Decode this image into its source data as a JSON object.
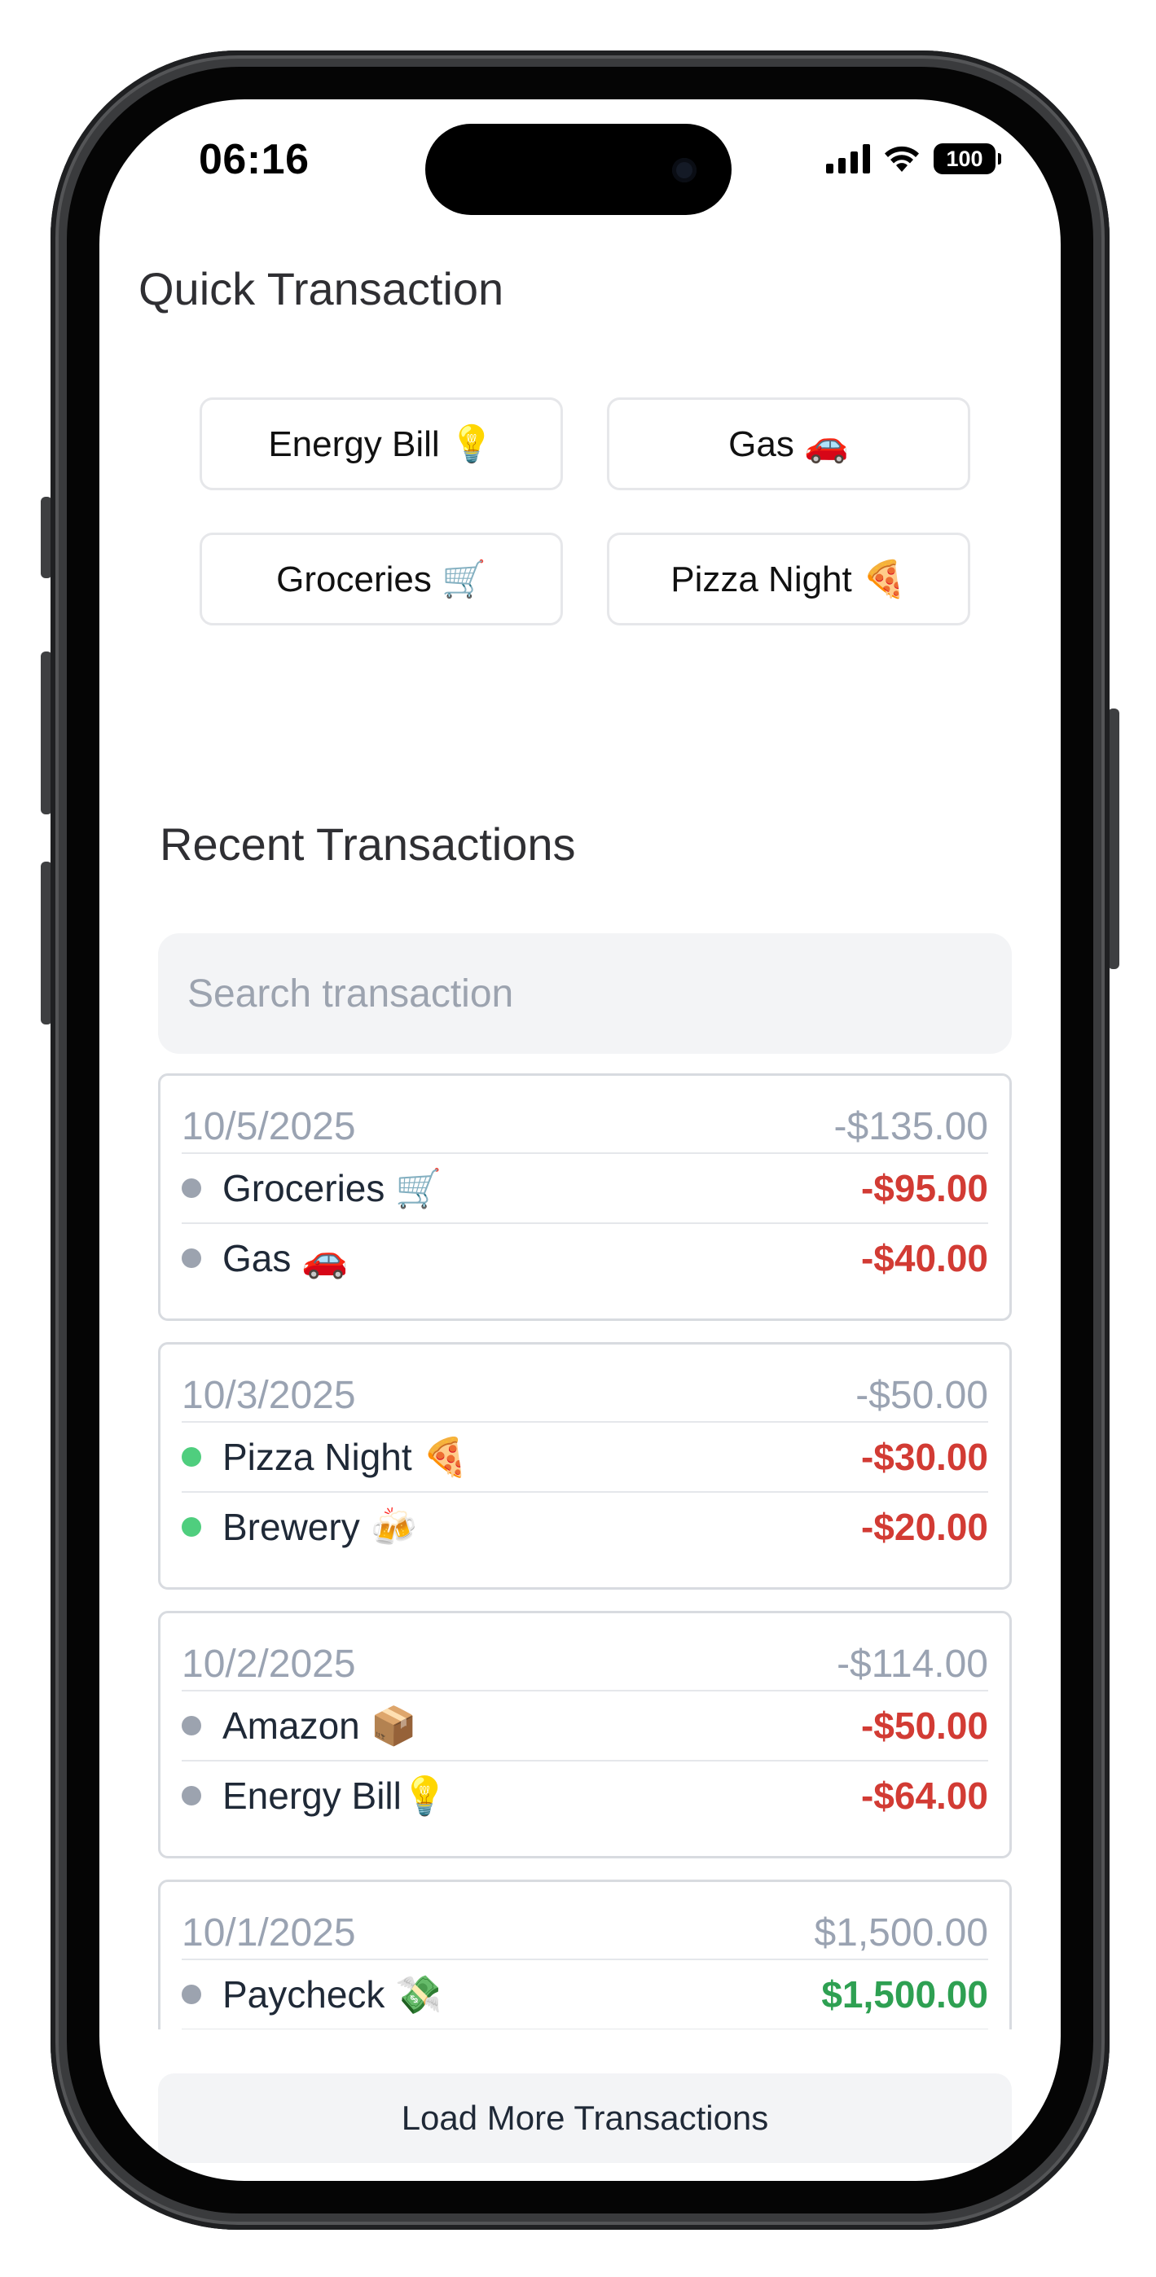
{
  "status_bar": {
    "time": "06:16",
    "battery": "100"
  },
  "quick": {
    "title": "Quick Transaction",
    "buttons": [
      {
        "label": "Energy Bill 💡"
      },
      {
        "label": "Gas 🚗"
      },
      {
        "label": "Groceries 🛒"
      },
      {
        "label": "Pizza Night 🍕"
      }
    ]
  },
  "recent": {
    "title": "Recent Transactions",
    "search_placeholder": "Search transaction",
    "groups": [
      {
        "date": "10/5/2025",
        "total": "-$135.00",
        "items": [
          {
            "name": "Groceries 🛒",
            "amount": "-$95.00",
            "dot_color": "#9ca3af",
            "amount_color": "#d23b34"
          },
          {
            "name": "Gas 🚗",
            "amount": "-$40.00",
            "dot_color": "#9ca3af",
            "amount_color": "#d23b34"
          }
        ]
      },
      {
        "date": "10/3/2025",
        "total": "-$50.00",
        "items": [
          {
            "name": "Pizza Night 🍕",
            "amount": "-$30.00",
            "dot_color": "#4fce7e",
            "amount_color": "#d23b34"
          },
          {
            "name": "Brewery 🍻",
            "amount": "-$20.00",
            "dot_color": "#4fce7e",
            "amount_color": "#d23b34"
          }
        ]
      },
      {
        "date": "10/2/2025",
        "total": "-$114.00",
        "items": [
          {
            "name": "Amazon 📦",
            "amount": "-$50.00",
            "dot_color": "#9ca3af",
            "amount_color": "#d23b34"
          },
          {
            "name": "Energy Bill💡",
            "amount": "-$64.00",
            "dot_color": "#9ca3af",
            "amount_color": "#d23b34"
          }
        ]
      },
      {
        "date": "10/1/2025",
        "total": "$1,500.00",
        "items": [
          {
            "name": "Paycheck 💸",
            "amount": "$1,500.00",
            "dot_color": "#9ca3af",
            "amount_color": "#2ea052"
          }
        ]
      }
    ],
    "load_more_label": "Load More Transactions"
  },
  "colors": {
    "negative": "#d23b34",
    "positive": "#2ea052",
    "muted": "#9aa3b2"
  }
}
